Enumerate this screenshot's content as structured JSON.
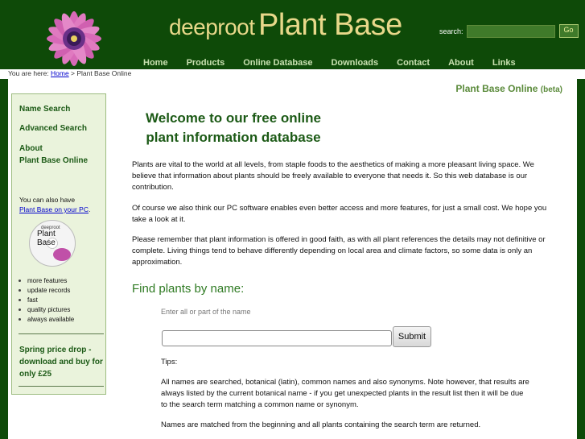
{
  "header": {
    "logo_small": "deeproot",
    "logo_big": "Plant Base",
    "search_label": "search:",
    "search_value": "",
    "go_label": "Go"
  },
  "nav": [
    "Home",
    "Products",
    "Online Database",
    "Downloads",
    "Contact",
    "About",
    "Links"
  ],
  "breadcrumb": {
    "prefix": "You are here:",
    "home": "Home",
    "current": "> Plant Base Online"
  },
  "section_title": "Plant Base Online",
  "section_beta": "(beta)",
  "sidebar": {
    "links": [
      "Name Search",
      "Advanced Search",
      "About",
      "Plant Base Online"
    ],
    "note": "You can also have",
    "pc_link": "Plant Base on your PC",
    "pc_dot": ".",
    "cd_small": "deeproot",
    "cd_big": "Plant Base",
    "features": [
      "more features",
      "update records",
      "fast",
      "quality pictures",
      "always available"
    ],
    "price_text": "Spring price drop - download and buy for only £25"
  },
  "main": {
    "title_line1": "Welcome to our free online",
    "title_line2": "plant information database",
    "para1": "Plants are vital to the world at all levels, from staple foods to the aesthetics of making a more pleasant living space. We believe that information about plants should be freely available to everyone that needs it. So this web database is our contribution.",
    "para2": "Of course we also think our PC software enables even better access and more features, for just a small cost. We hope you take a look at it.",
    "para3": "Please remember that plant information is offered in good faith, as with all plant references the details may not definitive or complete. Living things tend to behave differently depending on local area and climate factors, so some data is only an approximation.",
    "find_heading": "Find plants by name:",
    "find_hint": "Enter all or part of the name",
    "name_value": "",
    "submit_label": "Submit",
    "tips_label": "Tips:",
    "tip1": "All names are searched, botanical (latin), common names and also synonyms. Note however, that results are always listed by the current botanical name - if you get unexpected plants in the result list then it will be due to the search term matching a common name or synonym.",
    "tip2": "Names are matched from the beginning and all plants containing the search term are returned."
  }
}
